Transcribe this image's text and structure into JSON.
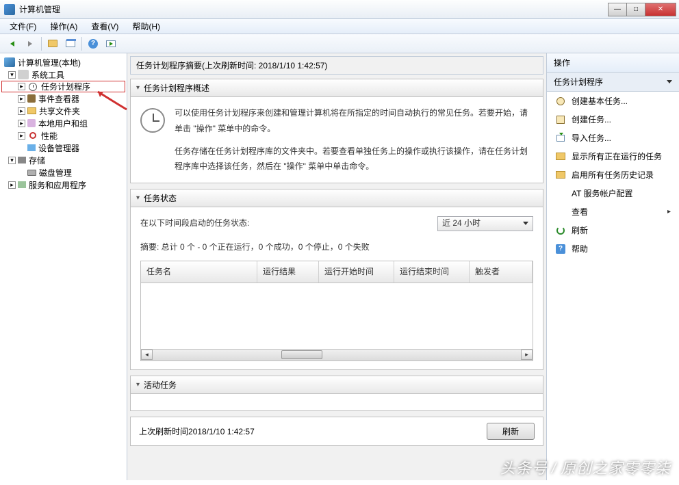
{
  "window": {
    "title": "计算机管理"
  },
  "menu": {
    "file": "文件(F)",
    "action": "操作(A)",
    "view": "查看(V)",
    "help": "帮助(H)"
  },
  "tree": {
    "root": "计算机管理(本地)",
    "system_tools": "系统工具",
    "scheduler": "任务计划程序",
    "event_viewer": "事件查看器",
    "shared_folders": "共享文件夹",
    "local_users": "本地用户和组",
    "performance": "性能",
    "device_manager": "设备管理器",
    "storage": "存储",
    "disk_mgmt": "磁盘管理",
    "services": "服务和应用程序"
  },
  "summary": {
    "header": "任务计划程序摘要(上次刷新时间: 2018/1/10 1:42:57)",
    "overview_title": "任务计划程序概述",
    "overview_p1": "可以使用任务计划程序来创建和管理计算机将在所指定的时间自动执行的常见任务。若要开始，请单击 \"操作\" 菜单中的命令。",
    "overview_p2": "任务存储在任务计划程序库的文件夹中。若要查看单独任务上的操作或执行该操作，请在任务计划程序库中选择该任务，然后在 \"操作\" 菜单中单击命令。",
    "status_title": "任务状态",
    "status_label": "在以下时间段启动的任务状态:",
    "period": "近 24 小时",
    "summary_line": "摘要: 总计 0 个 - 0 个正在运行，0 个成功，0 个停止，0 个失败",
    "cols": {
      "name": "任务名",
      "result": "运行结果",
      "start": "运行开始时间",
      "end": "运行结束时间",
      "trigger": "触发者"
    },
    "active_title": "活动任务",
    "last_refresh_label": "上次刷新时间",
    "last_refresh_time": "2018/1/10 1:42:57",
    "refresh_btn": "刷新"
  },
  "actions": {
    "header": "操作",
    "scope": "任务计划程序",
    "create_basic": "创建基本任务...",
    "create_task": "创建任务...",
    "import_task": "导入任务...",
    "show_running": "显示所有正在运行的任务",
    "enable_history": "启用所有任务历史记录",
    "at_account": "AT 服务帐户配置",
    "view": "查看",
    "refresh": "刷新",
    "help": "帮助"
  },
  "watermark": {
    "left": "头条号",
    "right": "原创之家零零柒"
  }
}
